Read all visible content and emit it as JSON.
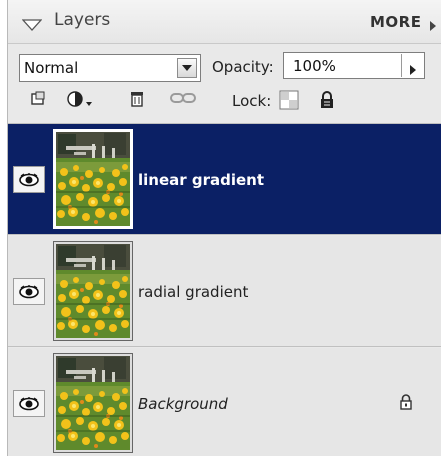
{
  "panel": {
    "title": "Layers",
    "more_label": "MORE",
    "collapse_icon": "collapse-triangle-icon",
    "more_icon": "more-arrow-icon"
  },
  "controls": {
    "blend_mode": "Normal",
    "opacity_label": "Opacity:",
    "opacity_value": "100%",
    "lock_label": "Lock:"
  },
  "tools": [
    {
      "name": "new-layer-icon"
    },
    {
      "name": "adjustment-layer-icon"
    },
    {
      "name": "delete-layer-icon"
    },
    {
      "name": "link-layers-icon"
    }
  ],
  "layers": [
    {
      "name": "linear gradient",
      "visible": true,
      "selected": true,
      "locked": false
    },
    {
      "name": "radial gradient",
      "visible": true,
      "selected": false,
      "locked": false
    },
    {
      "name": "Background",
      "visible": true,
      "selected": false,
      "locked": true
    }
  ],
  "colors": {
    "selected_row": "#0b2065",
    "panel_bg": "#e9e9e9",
    "flower_yellow": "#f2c21a",
    "foliage_green": "#5f8a2c"
  }
}
